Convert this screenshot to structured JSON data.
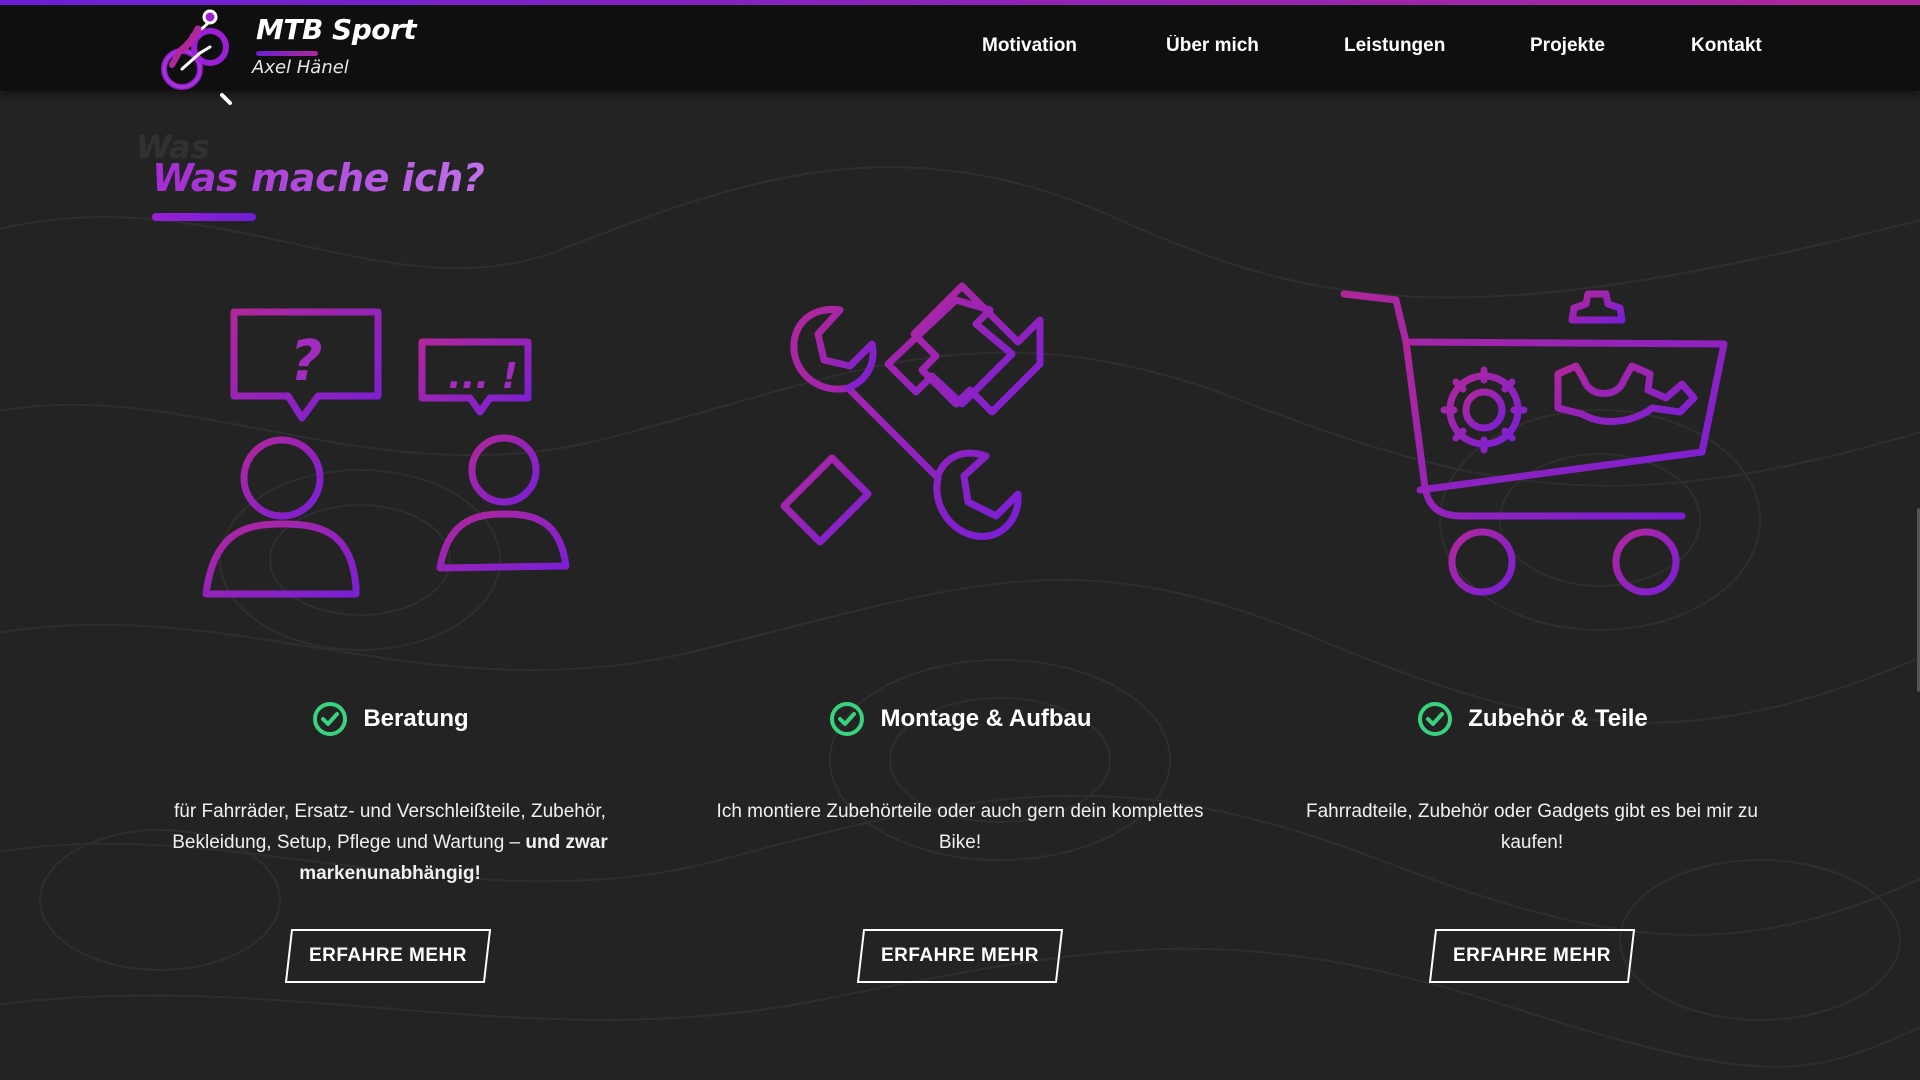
{
  "colors": {
    "accent_purple": "#9b1fd6",
    "accent_magenta": "#b0279c",
    "title_gradient_start": "#a32bd3",
    "title_gradient_end": "#c070e8",
    "check_green": "#39d27e",
    "header_bg": "#0f0f0f",
    "page_bg": "#232323"
  },
  "header": {
    "brand_title": "MTB Sport",
    "brand_subtitle": "Axel Hänel",
    "logo_icon": "mountain-biker-icon",
    "nav": [
      {
        "label": "Motivation"
      },
      {
        "label": "Über mich"
      },
      {
        "label": "Leistungen"
      },
      {
        "label": "Projekte"
      },
      {
        "label": "Kontakt"
      }
    ]
  },
  "section": {
    "ghost_title": "Was",
    "title": "Was mache ich?"
  },
  "services": [
    {
      "icon": "consultation-people-icon",
      "heading": "Beratung",
      "desc_plain": "für Fahrräder, Ersatz- und Verschleißteile, Zubehör, Bekleidung, Setup, Pflege und Wartung –",
      "desc_bold": "und zwar markenunabhängig!",
      "button": "ERFAHRE MEHR"
    },
    {
      "icon": "wrench-screwdriver-icon",
      "heading": "Montage & Aufbau",
      "desc_plain": "Ich montiere Zubehörteile oder auch gern dein komplettes Bike!",
      "desc_bold": "",
      "button": "ERFAHRE MEHR"
    },
    {
      "icon": "shopping-cart-gears-icon",
      "heading": "Zubehör & Teile",
      "desc_plain": "Fahrradteile, Zubehör oder Gadgets gibt es bei mir zu kaufen!",
      "desc_bold": "",
      "button": "ERFAHRE MEHR"
    }
  ]
}
